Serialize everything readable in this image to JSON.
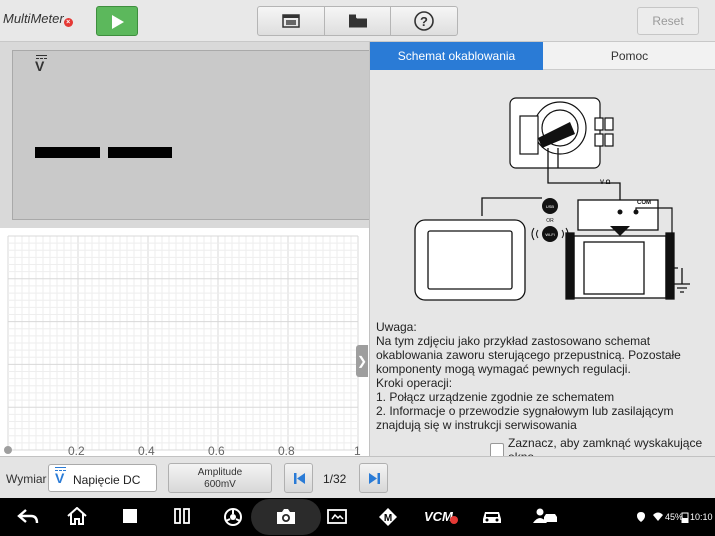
{
  "header": {
    "app_title": "MultiMeter",
    "play_icon": "play-icon",
    "tools": [
      "window-icon",
      "folder-icon",
      "help-icon"
    ],
    "reset_label": "Reset",
    "colors": {
      "play": "#5cb85c",
      "accent": "#2a7bd6"
    }
  },
  "display": {
    "unit_symbol": "V"
  },
  "chart": {
    "x_ticks": [
      "0",
      "0.2",
      "0.4",
      "0.6",
      "0.8",
      "1"
    ],
    "x_range": [
      0,
      1
    ]
  },
  "panel": {
    "tabs": [
      {
        "label": "Schemat okablowania",
        "active": true
      },
      {
        "label": "Pomoc",
        "active": false
      }
    ],
    "diagram_labels": {
      "v_ohm": "V Ω",
      "com": "COM",
      "usb": "USB",
      "or": "OR",
      "wifi": "Wi-Fi"
    },
    "note_lines": [
      "Uwaga:",
      "Na tym zdjęciu jako przykład zastosowano schemat",
      "okablowania zaworu sterującego przepustnicą. Pozostałe",
      "komponenty mogą wymagać pewnych regulacji.",
      "Kroki operacji:",
      "1. Połącz urządzenie zgodnie ze schematem",
      "2. Informacje o przewodzie sygnałowym lub zasilającym",
      "znajdują się w instrukcji serwisowania"
    ],
    "close_popup_label": "Zaznacz, aby zamknąć wyskakujące okno"
  },
  "controls": {
    "measure_label": "Wymiar",
    "measure_value": "Napięcie DC",
    "amplitude_title": "Amplitude",
    "amplitude_value": "600mV",
    "page_indicator": "1/32"
  },
  "status_bar": {
    "battery": "45%",
    "time": "10:10"
  }
}
